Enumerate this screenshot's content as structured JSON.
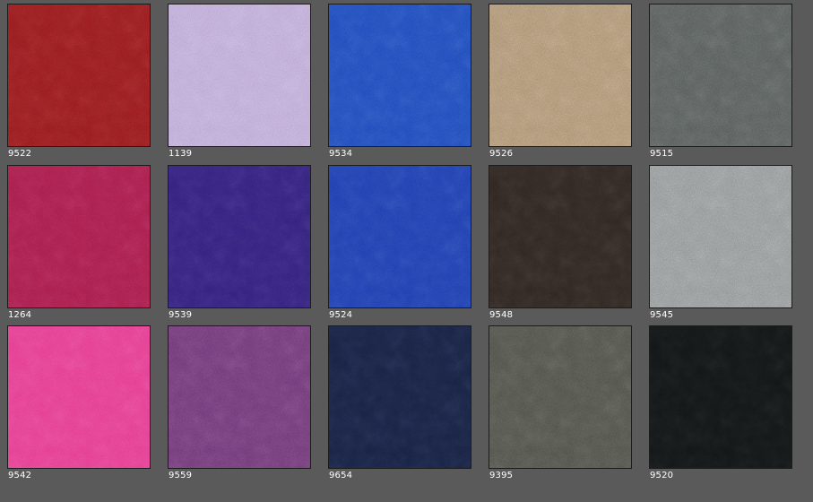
{
  "swatches": [
    {
      "code": "9522",
      "color": "#8e1a1c"
    },
    {
      "code": "1139",
      "color": "#b9a4d3"
    },
    {
      "code": "9534",
      "color": "#1f47b5"
    },
    {
      "code": "9526",
      "color": "#a88d6f"
    },
    {
      "code": "9515",
      "color": "#545957"
    },
    {
      "code": "1264",
      "color": "#a01c46"
    },
    {
      "code": "9539",
      "color": "#2f1f73"
    },
    {
      "code": "9524",
      "color": "#1e3ba8"
    },
    {
      "code": "9548",
      "color": "#2b231f"
    },
    {
      "code": "9545",
      "color": "#8e9293"
    },
    {
      "code": "9542",
      "color": "#e23a86"
    },
    {
      "code": "9559",
      "color": "#6a3770"
    },
    {
      "code": "9654",
      "color": "#161f3d"
    },
    {
      "code": "9395",
      "color": "#4d4e47"
    },
    {
      "code": "9520",
      "color": "#111414"
    }
  ]
}
